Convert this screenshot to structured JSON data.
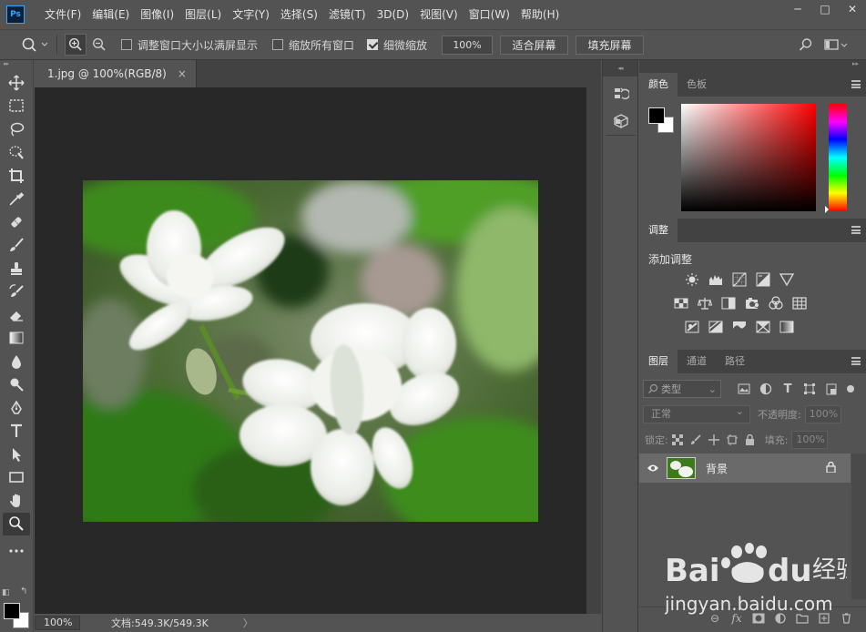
{
  "app": {
    "logo": "Ps",
    "menu": [
      "文件(F)",
      "编辑(E)",
      "图像(I)",
      "图层(L)",
      "文字(Y)",
      "选择(S)",
      "滤镜(T)",
      "3D(D)",
      "视图(V)",
      "窗口(W)",
      "帮助(H)"
    ],
    "window_controls": [
      "─",
      "□",
      "✕"
    ]
  },
  "options": {
    "checkbox_resize": "调整窗口大小以满屏显示",
    "checkbox_zoom_all": "缩放所有窗口",
    "checkbox_scrubby": "细微缩放",
    "zoom_value": "100%",
    "fit_screen": "适合屏幕",
    "fill_screen": "填充屏幕",
    "checked": {
      "resize": false,
      "zoom_all": false,
      "scrubby": true
    }
  },
  "document": {
    "tab_title": "1.jpg @ 100%(RGB/8)",
    "tab_close": "×",
    "status_zoom": "100%",
    "status_doc": "文档:549.3K/549.3K",
    "status_arrow": "〉"
  },
  "panels": {
    "color": {
      "tabs": [
        "颜色",
        "色板"
      ],
      "foreground": "#000000",
      "background": "#ffffff"
    },
    "adjustments": {
      "tab": "调整",
      "title": "添加调整"
    },
    "layers": {
      "tabs": [
        "图层",
        "通道",
        "路径"
      ],
      "kind_placeholder": "类型",
      "blend_mode": "正常",
      "opacity_label": "不透明度:",
      "opacity_value": "100%",
      "lock_label": "锁定:",
      "fill_label": "填充:",
      "fill_value": "100%",
      "layer": {
        "name": "背景"
      }
    }
  },
  "watermark": {
    "brand": "Bai",
    "brand2": "du",
    "cn": "经验",
    "url": "jingyan.baidu.com"
  },
  "colors": {
    "accent": "#31a8ff",
    "ui_bg": "#535353",
    "canvas_bg": "#282828",
    "dark_bar": "#424242"
  }
}
